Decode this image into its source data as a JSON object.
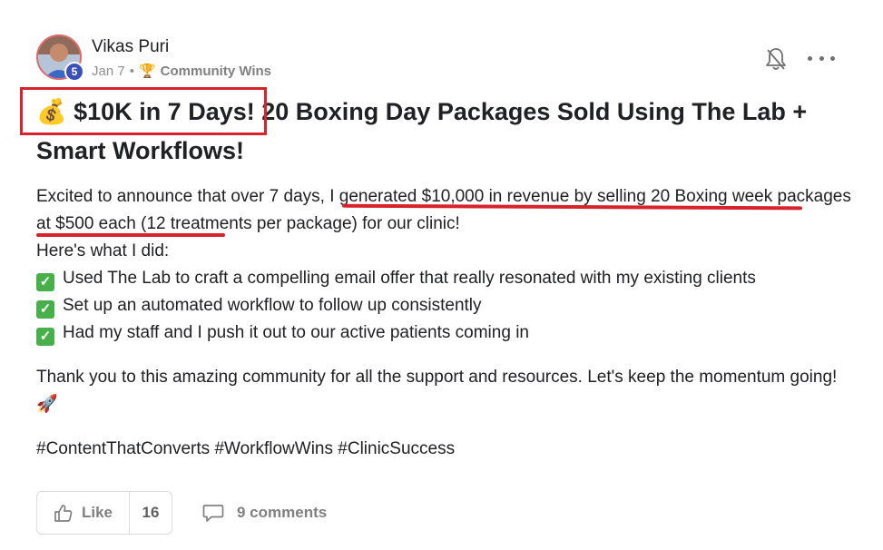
{
  "post": {
    "author": "Vikas Puri",
    "level": "5",
    "date": "Jan 7",
    "separator": "•",
    "category_icon": "trophy-icon",
    "category": "Community Wins",
    "title_emoji": "💰",
    "title_part1": "$10K in 7 Days!",
    "title_part2": " 20 Boxing Day Packages Sold Using The Lab + Smart Workflows!",
    "intro_before": "Excited to announce that over 7 days, ",
    "intro_highlight": "I generated $10,000 in revenue by selling 20 Boxing week packages at $500 each",
    "intro_after": " (12 treatments per package) for our clinic!",
    "steps_heading": "Here's what I did:",
    "steps": [
      "Used The Lab to craft a compelling email offer that really resonated with my existing clients",
      "Set up an automated workflow to follow up consistently",
      "Had my staff and I push it out to our active patients coming in"
    ],
    "thanks": "Thank you to this amazing community for all the support and resources. Let's keep the momentum going!",
    "thanks_emoji": "🚀",
    "hashtags": "#ContentThatConverts #WorkflowWins #ClinicSuccess"
  },
  "actions": {
    "like_label": "Like",
    "like_count": "16",
    "comments_label": "9 comments"
  },
  "icons": [
    "avatar",
    "bell-off-icon",
    "more-icon",
    "thumbs-up-icon",
    "comment-icon",
    "check-icon",
    "money-bag-icon",
    "rocket-icon"
  ],
  "colors": {
    "annotation_red": "#d7232b",
    "level_badge": "#3b4fb8",
    "check_green": "#47b04b"
  }
}
